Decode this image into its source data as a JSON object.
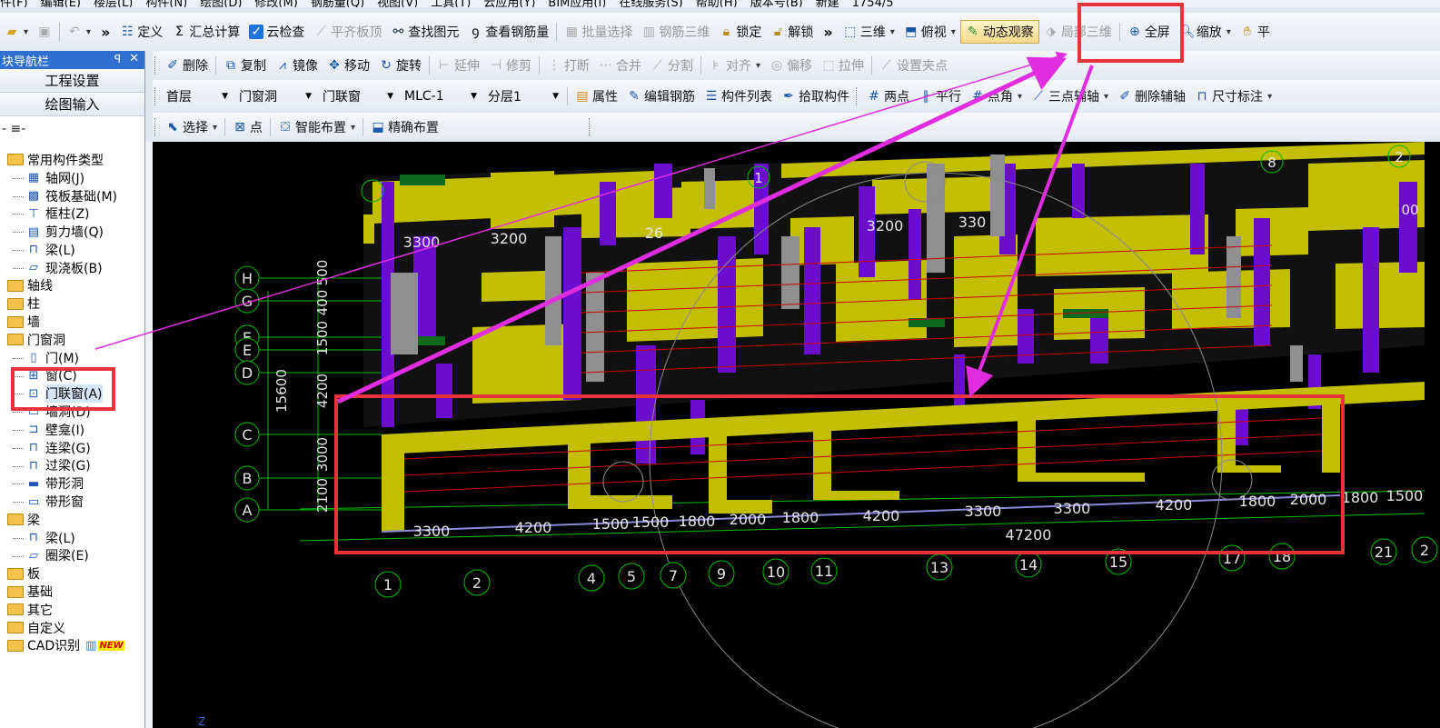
{
  "menu": [
    "件(F)",
    "编辑(E)",
    "楼层(L)",
    "构件(N)",
    "绘图(D)",
    "修改(M)",
    "钢筋量(Q)",
    "视图(V)",
    "工具(T)",
    "云应用(Y)",
    "BIM应用(I)",
    "在线服务(S)",
    "帮助(H)",
    "版本号(B)",
    "新建",
    "1754/5"
  ],
  "toolbar1": {
    "define": "定义",
    "sum": "汇总计算",
    "cloud_check": "云检查",
    "flat_top": "平齐板顶",
    "find": "查找图元",
    "view_rebar": "查看钢筋量",
    "batch_select": "批量选择",
    "rebar_3d": "钢筋三维",
    "lock": "锁定",
    "unlock": "解锁",
    "three_d": "三维",
    "top_view": "俯视",
    "dynamic_view": "动态观察",
    "local_3d": "局部三维",
    "fullscreen": "全屏",
    "zoom": "缩放",
    "pan": "平"
  },
  "toolbar2": {
    "delete": "删除",
    "copy": "复制",
    "mirror": "镜像",
    "move": "移动",
    "rotate": "旋转",
    "extend": "延伸",
    "trim": "修剪",
    "break": "打断",
    "merge": "合并",
    "split": "分割",
    "align": "对齐",
    "offset": "偏移",
    "stretch": "拉伸",
    "set_grip": "设置夹点"
  },
  "toolbar3": {
    "floor": "首层",
    "category": "门窗洞",
    "type": "门联窗",
    "component": "MLC-1",
    "layer": "分层1",
    "properties": "属性",
    "edit_rebar": "编辑钢筋",
    "component_list": "构件列表",
    "pick": "拾取构件",
    "two_point": "两点",
    "parallel": "平行",
    "point_angle": "点角",
    "three_point_aux": "三点辅轴",
    "delete_aux": "删除辅轴",
    "dim": "尺寸标注"
  },
  "toolbar4": {
    "select": "选择",
    "point": "点",
    "smart_layout": "智能布置",
    "precise_layout": "精确布置"
  },
  "nav": {
    "title": "块导航栏",
    "pin": "ꟼ",
    "close": "✕",
    "project_settings": "工程设置",
    "drawing_input": "绘图输入",
    "mini": "- ≡-"
  },
  "tree": [
    {
      "label": "常用构件类型",
      "level": 1,
      "expanded": true
    },
    {
      "label": "轴网(J)",
      "level": 2,
      "icon": "grid-icon"
    },
    {
      "label": "筏板基础(M)",
      "level": 2,
      "icon": "raft-icon"
    },
    {
      "label": "框柱(Z)",
      "level": 2,
      "icon": "column-icon"
    },
    {
      "label": "剪力墙(Q)",
      "level": 2,
      "icon": "wall-icon"
    },
    {
      "label": "梁(L)",
      "level": 2,
      "icon": "beam-icon"
    },
    {
      "label": "现浇板(B)",
      "level": 2,
      "icon": "slab-icon"
    },
    {
      "label": "轴线",
      "level": 1
    },
    {
      "label": "柱",
      "level": 1
    },
    {
      "label": "墙",
      "level": 1
    },
    {
      "label": "门窗洞",
      "level": 1,
      "expanded": true
    },
    {
      "label": "门(M)",
      "level": 2,
      "icon": "door-icon"
    },
    {
      "label": "窗(C)",
      "level": 2,
      "icon": "window-icon"
    },
    {
      "label": "门联窗(A)",
      "level": 2,
      "icon": "door-window-icon",
      "selected": true
    },
    {
      "label": "墙洞(D)",
      "level": 2,
      "icon": "wall-hole-icon"
    },
    {
      "label": "壁龛(I)",
      "level": 2,
      "icon": "niche-icon"
    },
    {
      "label": "连梁(G)",
      "level": 2,
      "icon": "coupling-beam-icon"
    },
    {
      "label": "过梁(G)",
      "level": 2,
      "icon": "lintel-icon"
    },
    {
      "label": "带形洞",
      "level": 2,
      "icon": "strip-hole-icon"
    },
    {
      "label": "带形窗",
      "level": 2,
      "icon": "strip-window-icon"
    },
    {
      "label": "梁",
      "level": 1,
      "expanded": true
    },
    {
      "label": "梁(L)",
      "level": 2,
      "icon": "beam-icon"
    },
    {
      "label": "圈梁(E)",
      "level": 2,
      "icon": "ring-beam-icon"
    },
    {
      "label": "板",
      "level": 1
    },
    {
      "label": "基础",
      "level": 1
    },
    {
      "label": "其它",
      "level": 1
    },
    {
      "label": "自定义",
      "level": 1
    },
    {
      "label": "CAD识别",
      "level": 1,
      "badge": "NEW"
    }
  ],
  "canvas": {
    "row_axes": [
      "H",
      "G",
      "E",
      "E",
      "D",
      "C",
      "B",
      "A"
    ],
    "col_axes": [
      "1",
      "2",
      "4",
      "5",
      "7",
      "9",
      "10",
      "11",
      "13",
      "14",
      "15",
      "17",
      "18",
      "21",
      "2"
    ],
    "vertical_dims": [
      "15600",
      "4200",
      "1500",
      "400",
      "500",
      "3000",
      "2100"
    ],
    "bottom_dims": [
      "3300",
      "4200",
      "1500",
      "1500",
      "1800",
      "2000",
      "1800",
      "4200",
      "3300",
      "3300",
      "4200",
      "1800",
      "2000",
      "1800",
      "1500"
    ],
    "total_dim": "47200",
    "top_dims": [
      "3300",
      "3200",
      "26",
      "3200",
      "330"
    ],
    "top_axes": [
      "1",
      "8",
      "2"
    ],
    "side_dim": "00",
    "axis_z": "Z"
  },
  "colors": {
    "wall_yellow": "#c4be00",
    "purple": "#6a0dcc",
    "gray": "#8f8f8f",
    "green_beam": "#0b6b1a",
    "grid_green": "#00c000",
    "highlight_red": "#e8333b",
    "arrow_magenta": "#e02de0"
  }
}
